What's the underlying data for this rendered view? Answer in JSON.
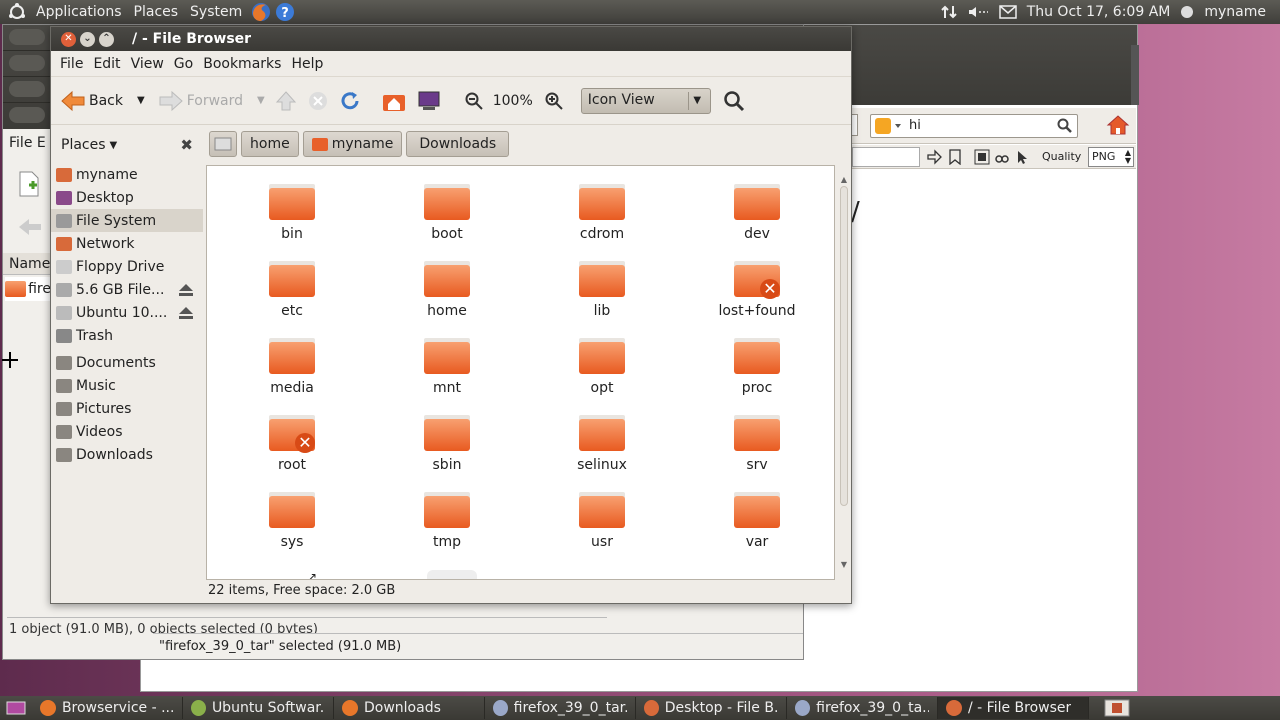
{
  "top_panel": {
    "menus": [
      "Applications",
      "Places",
      "System"
    ],
    "clock": "Thu Oct 17,  6:09 AM",
    "user": "myname"
  },
  "bg_browser": {
    "search_value": "hi",
    "quality_label": "Quality",
    "format_value": "PNG",
    "slash": "/"
  },
  "bg_downloads": {
    "menu_file": "File",
    "menu_e": "E",
    "col_name": "Name",
    "row1": "fire",
    "status_partial": "1 object (91.0 MB), 0 objects selected (0 bytes)",
    "status_selected": "\"firefox_39_0_tar\" selected (91.0 MB)"
  },
  "main": {
    "title": "/ - File Browser",
    "menus": [
      "File",
      "Edit",
      "View",
      "Go",
      "Bookmarks",
      "Help"
    ],
    "toolbar": {
      "back": "Back",
      "forward": "Forward",
      "zoom": "100%",
      "view_mode": "Icon View"
    },
    "places_label": "Places",
    "sidebar_items": [
      {
        "label": "myname",
        "color": "#d86a3a"
      },
      {
        "label": "Desktop",
        "color": "#8a4a8a"
      },
      {
        "label": "File System",
        "color": "#9a9a9a",
        "selected": true
      },
      {
        "label": "Network",
        "color": "#d86a3a"
      },
      {
        "label": "Floppy Drive",
        "color": "#cccccc"
      },
      {
        "label": "5.6 GB File...",
        "color": "#aaaaaa",
        "eject": true
      },
      {
        "label": "Ubuntu 10....",
        "color": "#bbbbbb",
        "eject": true
      },
      {
        "label": "Trash",
        "color": "#888888"
      }
    ],
    "bookmark_items": [
      "Documents",
      "Music",
      "Pictures",
      "Videos",
      "Downloads"
    ],
    "path_buttons": [
      "home",
      "myname",
      "Downloads"
    ],
    "files": [
      {
        "name": "bin"
      },
      {
        "name": "boot"
      },
      {
        "name": "cdrom"
      },
      {
        "name": "dev"
      },
      {
        "name": "etc"
      },
      {
        "name": "home"
      },
      {
        "name": "lib"
      },
      {
        "name": "lost+found",
        "locked": true
      },
      {
        "name": "media"
      },
      {
        "name": "mnt"
      },
      {
        "name": "opt"
      },
      {
        "name": "proc"
      },
      {
        "name": "root",
        "locked": true
      },
      {
        "name": "sbin"
      },
      {
        "name": "selinux"
      },
      {
        "name": "srv"
      },
      {
        "name": "sys"
      },
      {
        "name": "tmp"
      },
      {
        "name": "usr"
      },
      {
        "name": "var"
      }
    ],
    "status": "22 items, Free space: 2.0 GB"
  },
  "taskbar": [
    {
      "label": "Browservice - ...",
      "color": "#e8772a"
    },
    {
      "label": "Ubuntu Softwar...",
      "color": "#8ab04a"
    },
    {
      "label": "Downloads",
      "color": "#e8772a"
    },
    {
      "label": "firefox_39_0_tar...",
      "color": "#9aa8c8"
    },
    {
      "label": "Desktop - File B...",
      "color": "#d86a3a"
    },
    {
      "label": "firefox_39_0_ta...",
      "color": "#9aa8c8"
    },
    {
      "label": "/ - File Browser",
      "color": "#d86a3a",
      "active": true
    }
  ]
}
